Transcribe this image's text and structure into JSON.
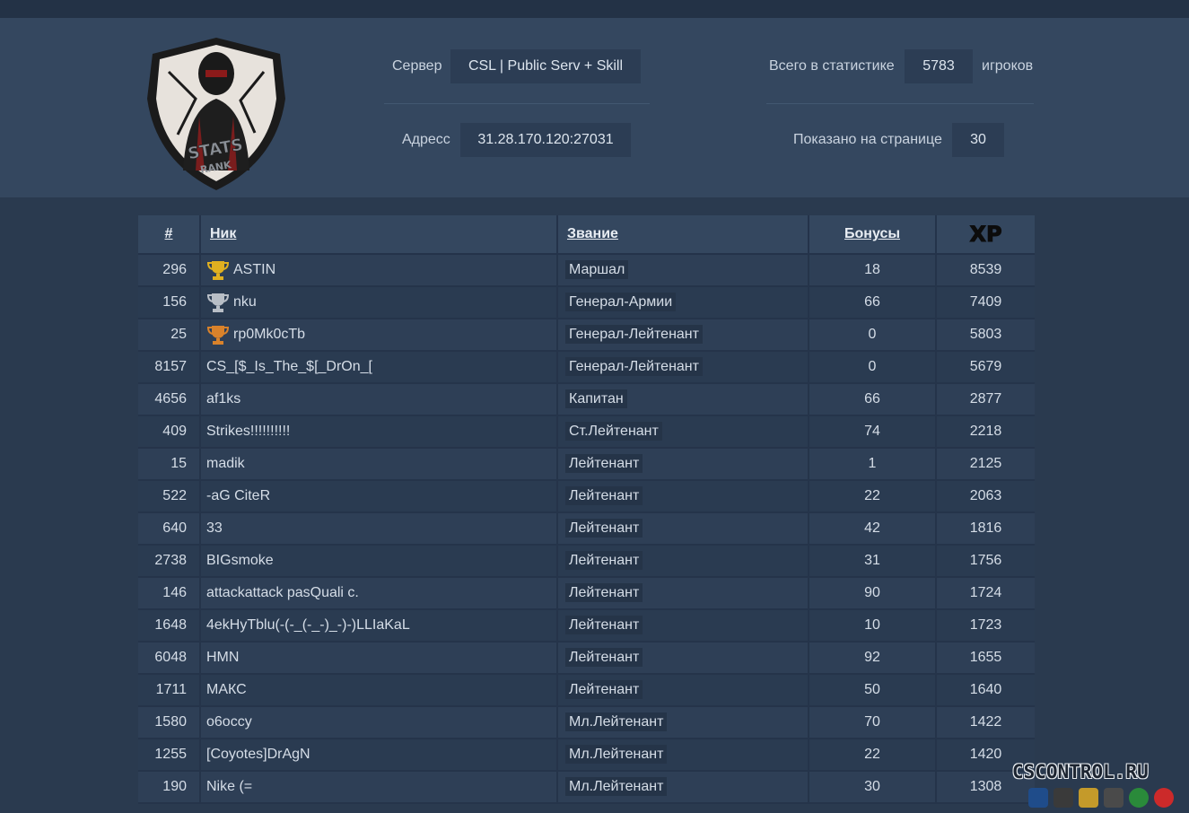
{
  "header": {
    "server_label": "Сервер",
    "server_value": "CSL | Public Serv + Skill",
    "address_label": "Адресс",
    "address_value": "31.28.170.120:27031",
    "total_label": "Всего в статистике",
    "total_value": "5783",
    "total_suffix": "игроков",
    "perpage_label": "Показано на странице",
    "perpage_value": "30",
    "logo_text": "STATS RANK"
  },
  "table": {
    "columns": [
      "#",
      "Ник",
      "Звание",
      "Бонусы",
      "XP"
    ],
    "rows": [
      {
        "num": "296",
        "nick": "ASTIN",
        "rank": "Маршал",
        "bonus": "18",
        "xp": "8539",
        "cup": "gold"
      },
      {
        "num": "156",
        "nick": "nku",
        "rank": "Генерал-Армии",
        "bonus": "66",
        "xp": "7409",
        "cup": "silver"
      },
      {
        "num": "25",
        "nick": "rp0Mk0cTb",
        "rank": "Генерал-Лейтенант",
        "bonus": "0",
        "xp": "5803",
        "cup": "bronze"
      },
      {
        "num": "8157",
        "nick": "CS_[$_Is_The_$[_DrOn_[",
        "rank": "Генерал-Лейтенант",
        "bonus": "0",
        "xp": "5679",
        "cup": ""
      },
      {
        "num": "4656",
        "nick": "af1ks",
        "rank": "Капитан",
        "bonus": "66",
        "xp": "2877",
        "cup": ""
      },
      {
        "num": "409",
        "nick": "Strikes!!!!!!!!!!",
        "rank": "Ст.Лейтенант",
        "bonus": "74",
        "xp": "2218",
        "cup": ""
      },
      {
        "num": "15",
        "nick": "madik",
        "rank": "Лейтенант",
        "bonus": "1",
        "xp": "2125",
        "cup": ""
      },
      {
        "num": "522",
        "nick": "-aG CiteR",
        "rank": "Лейтенант",
        "bonus": "22",
        "xp": "2063",
        "cup": ""
      },
      {
        "num": "640",
        "nick": "33",
        "rank": "Лейтенант",
        "bonus": "42",
        "xp": "1816",
        "cup": ""
      },
      {
        "num": "2738",
        "nick": "BIGsmoke",
        "rank": "Лейтенант",
        "bonus": "31",
        "xp": "1756",
        "cup": ""
      },
      {
        "num": "146",
        "nick": "attackattack pasQuali c.",
        "rank": "Лейтенант",
        "bonus": "90",
        "xp": "1724",
        "cup": ""
      },
      {
        "num": "1648",
        "nick": "4ekHyTblu(-(-_(-_-)_-)-)LLIaKaL",
        "rank": "Лейтенант",
        "bonus": "10",
        "xp": "1723",
        "cup": ""
      },
      {
        "num": "6048",
        "nick": "HMN",
        "rank": "Лейтенант",
        "bonus": "92",
        "xp": "1655",
        "cup": ""
      },
      {
        "num": "1711",
        "nick": "МАКС",
        "rank": "Лейтенант",
        "bonus": "50",
        "xp": "1640",
        "cup": ""
      },
      {
        "num": "1580",
        "nick": "o6occy",
        "rank": "Мл.Лейтенант",
        "bonus": "70",
        "xp": "1422",
        "cup": ""
      },
      {
        "num": "1255",
        "nick": "[Coyotes]DrAgN",
        "rank": "Мл.Лейтенант",
        "bonus": "22",
        "xp": "1420",
        "cup": ""
      },
      {
        "num": "190",
        "nick": "Nike (=",
        "rank": "Мл.Лейтенант",
        "bonus": "30",
        "xp": "1308",
        "cup": ""
      }
    ]
  },
  "watermark": "CSCONTROL.RU",
  "colors": {
    "background": "#2a3a4f",
    "header": "#34475f",
    "gold": "#e0b020",
    "silver": "#b8bec6",
    "bronze": "#d9822b"
  }
}
